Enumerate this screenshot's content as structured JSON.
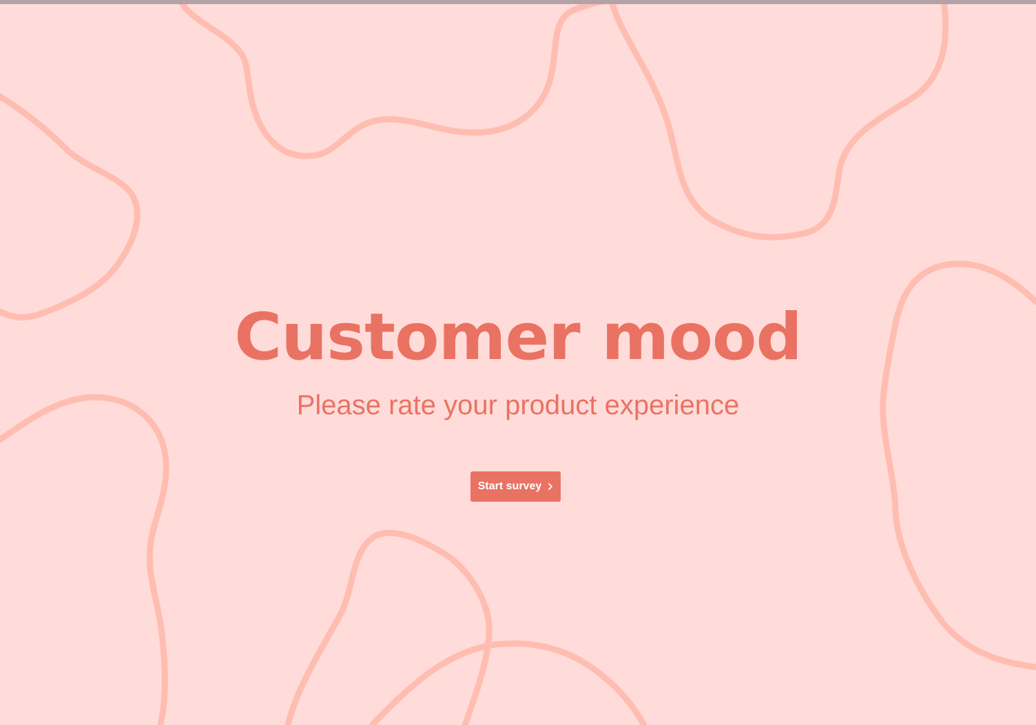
{
  "theme": {
    "background": "#ffdcd9",
    "accent": "#ea7263",
    "blob_stroke": "#ffbdb2",
    "topbar": "#b3a3a6",
    "button_text": "#ffffff"
  },
  "hero": {
    "title": "Customer mood",
    "subtitle": "Please rate your product experience"
  },
  "start_button": {
    "label": "Start survey",
    "icon": "chevron-right-icon"
  }
}
